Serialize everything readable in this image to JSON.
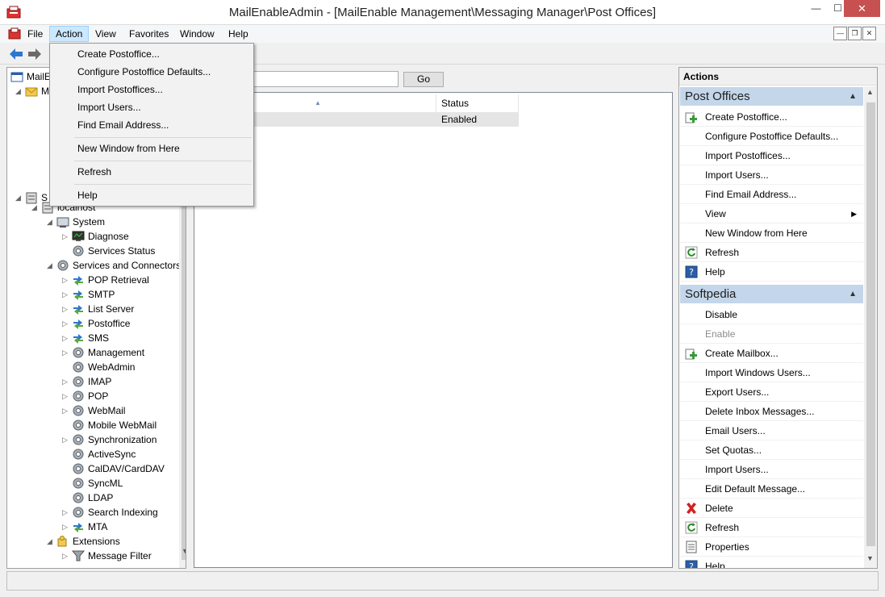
{
  "window": {
    "title": "MailEnableAdmin - [MailEnable Management\\Messaging Manager\\Post Offices]",
    "minimize": "—",
    "maximize": "☐",
    "close": "✕"
  },
  "menubar": {
    "items": [
      "File",
      "Action",
      "View",
      "Favorites",
      "Window",
      "Help"
    ],
    "active": "Action",
    "mdi": {
      "min": "—",
      "restore": "❐",
      "close": "✕"
    }
  },
  "action_menu": {
    "items": [
      "Create Postoffice...",
      "Configure Postoffice Defaults...",
      "Import Postoffices...",
      "Import Users...",
      "Find Email Address...",
      "New Window from Here",
      "Refresh",
      "Help"
    ]
  },
  "tree": {
    "top_items": [
      {
        "label": "MailE",
        "icon": "console-icon"
      },
      {
        "label": "M",
        "icon": "mail-folder-icon"
      },
      {
        "label": "S",
        "icon": "server-icon"
      }
    ],
    "items": [
      {
        "label": "localhost",
        "icon": "server-icon",
        "expander": "◢"
      },
      {
        "label": "System",
        "icon": "system-icon",
        "expander": "◢"
      },
      {
        "label": "Diagnose",
        "icon": "monitor-icon",
        "expander": "▷"
      },
      {
        "label": "Services Status",
        "icon": "gear-icon",
        "expander": ""
      },
      {
        "label": "Services and Connectors",
        "icon": "gear-icon",
        "expander": "◢"
      },
      {
        "label": "POP Retrieval",
        "icon": "connector-arrows-icon",
        "expander": "▷"
      },
      {
        "label": "SMTP",
        "icon": "connector-arrows-icon",
        "expander": "▷"
      },
      {
        "label": "List Server",
        "icon": "connector-arrows-icon",
        "expander": "▷"
      },
      {
        "label": "Postoffice",
        "icon": "connector-arrows-icon",
        "expander": "▷"
      },
      {
        "label": "SMS",
        "icon": "connector-arrows-icon",
        "expander": "▷"
      },
      {
        "label": "Management",
        "icon": "gear-icon",
        "expander": "▷"
      },
      {
        "label": "WebAdmin",
        "icon": "gear-icon",
        "expander": ""
      },
      {
        "label": "IMAP",
        "icon": "gear-icon",
        "expander": "▷"
      },
      {
        "label": "POP",
        "icon": "gear-icon",
        "expander": "▷"
      },
      {
        "label": "WebMail",
        "icon": "gear-icon",
        "expander": "▷"
      },
      {
        "label": "Mobile WebMail",
        "icon": "gear-icon",
        "expander": ""
      },
      {
        "label": "Synchronization",
        "icon": "gear-icon",
        "expander": "▷"
      },
      {
        "label": "ActiveSync",
        "icon": "gear-icon",
        "expander": ""
      },
      {
        "label": "CalDAV/CardDAV",
        "icon": "gear-icon",
        "expander": ""
      },
      {
        "label": "SyncML",
        "icon": "gear-icon",
        "expander": ""
      },
      {
        "label": "LDAP",
        "icon": "gear-icon",
        "expander": ""
      },
      {
        "label": "Search Indexing",
        "icon": "gear-icon",
        "expander": "▷"
      },
      {
        "label": "MTA",
        "icon": "connector-arrows-icon",
        "expander": "▷"
      },
      {
        "label": "Extensions",
        "icon": "puzzle-icon",
        "expander": "◢"
      },
      {
        "label": "Message Filter",
        "icon": "filter-icon",
        "expander": "▷"
      }
    ]
  },
  "center": {
    "search_value": "",
    "go_label": "Go",
    "columns": [
      "",
      "Status"
    ],
    "rows": [
      {
        "name": "",
        "status": "Enabled"
      }
    ]
  },
  "actions": {
    "header": "Actions",
    "sections": [
      {
        "title": "Post Offices",
        "items": [
          {
            "label": "Create Postoffice...",
            "icon": "add-icon"
          },
          {
            "label": "Configure Postoffice Defaults...",
            "icon": ""
          },
          {
            "label": "Import Postoffices...",
            "icon": ""
          },
          {
            "label": "Import Users...",
            "icon": ""
          },
          {
            "label": "Find Email Address...",
            "icon": ""
          },
          {
            "label": "View",
            "icon": "",
            "submenu": true
          },
          {
            "label": "New Window from Here",
            "icon": ""
          },
          {
            "label": "Refresh",
            "icon": "refresh-icon"
          },
          {
            "label": "Help",
            "icon": "help-icon"
          }
        ]
      },
      {
        "title": "Softpedia",
        "items": [
          {
            "label": "Disable",
            "icon": ""
          },
          {
            "label": "Enable",
            "icon": "",
            "disabled": true
          },
          {
            "label": "Create Mailbox...",
            "icon": "add-icon"
          },
          {
            "label": "Import Windows Users...",
            "icon": ""
          },
          {
            "label": "Export Users...",
            "icon": ""
          },
          {
            "label": "Delete Inbox Messages...",
            "icon": ""
          },
          {
            "label": "Email Users...",
            "icon": ""
          },
          {
            "label": "Set Quotas...",
            "icon": ""
          },
          {
            "label": "Import Users...",
            "icon": ""
          },
          {
            "label": "Edit Default Message...",
            "icon": ""
          },
          {
            "label": "Delete",
            "icon": "delete-icon"
          },
          {
            "label": "Refresh",
            "icon": "refresh-icon"
          },
          {
            "label": "Properties",
            "icon": "properties-icon"
          },
          {
            "label": "Help",
            "icon": "help-icon"
          }
        ]
      }
    ]
  }
}
